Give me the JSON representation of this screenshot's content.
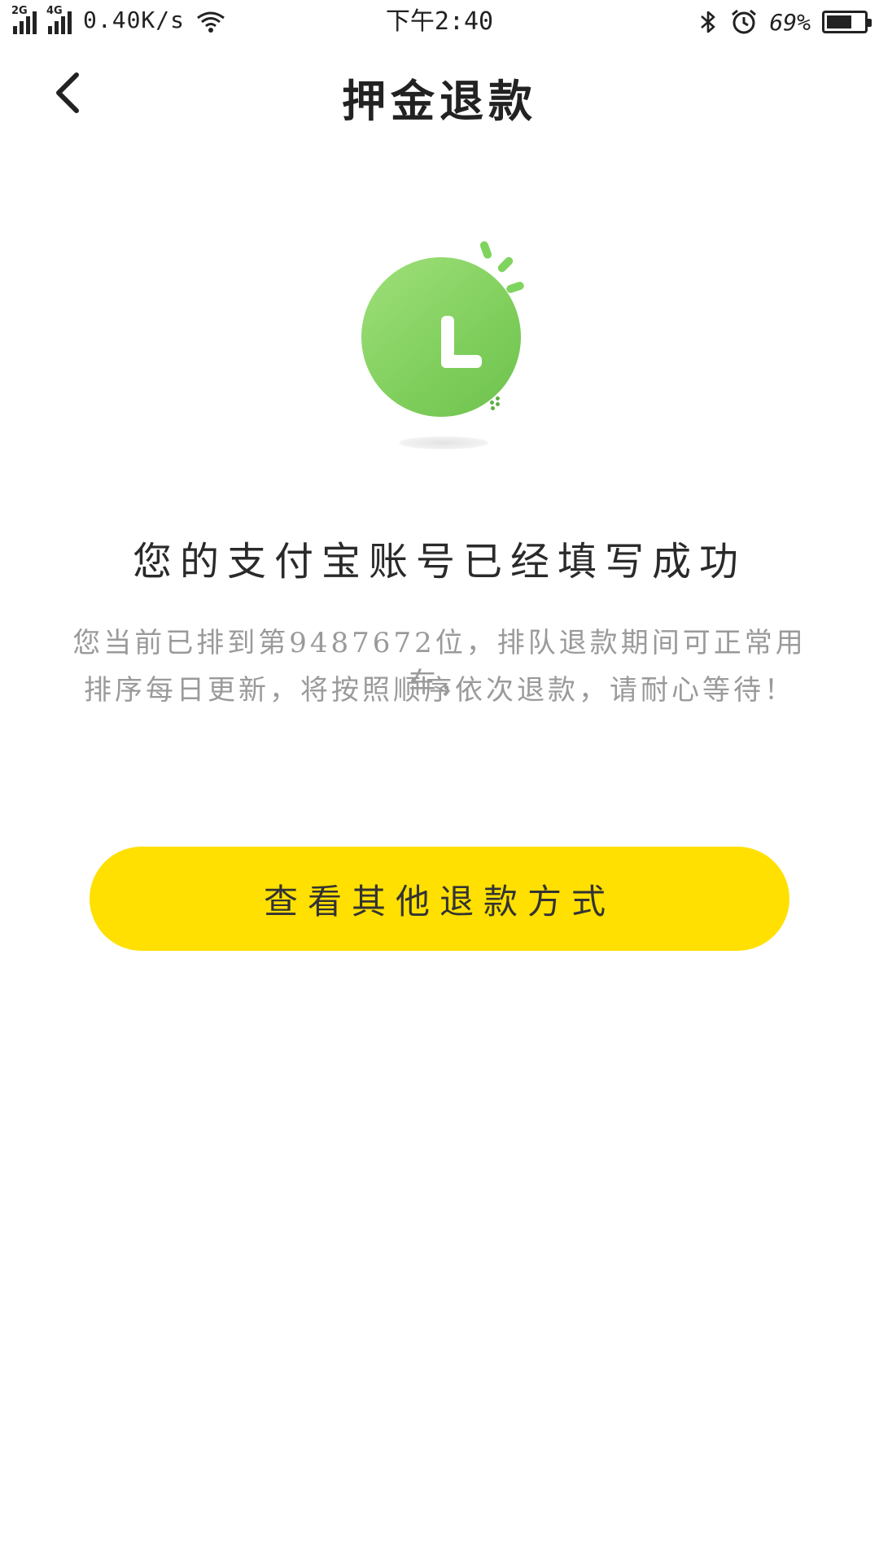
{
  "status_bar": {
    "sim1_tag": "2G",
    "sim2_tag": "4G",
    "net_speed": "0.40K/s",
    "time": "下午2:40",
    "battery_percent": "69%",
    "battery_level": 0.69,
    "icons": [
      "signal-icon",
      "wifi-icon",
      "bluetooth-icon",
      "alarm-icon",
      "battery-icon"
    ]
  },
  "nav": {
    "title": "押金退款",
    "back_icon": "chevron-left-icon"
  },
  "illustration": {
    "icon": "clock-icon",
    "color": "#8ad567"
  },
  "message": {
    "headline": "您的支付宝账号已经填写成功",
    "line1": "您当前已排到第9487672位，排队退款期间可正常用车，",
    "line2": "排序每日更新，将按照顺序依次退款，请耐心等待！"
  },
  "actions": {
    "other_refund_label": "查看其他退款方式",
    "button_color": "#ffe000"
  }
}
